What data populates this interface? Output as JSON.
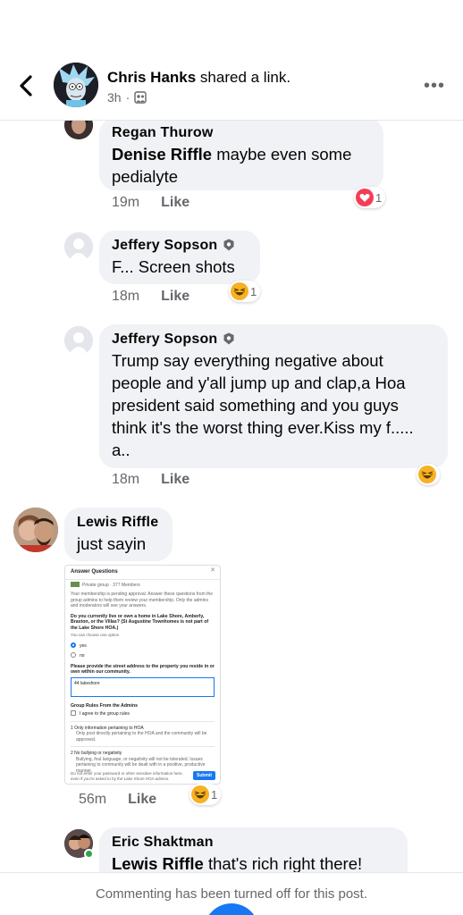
{
  "post_header": {
    "author": "Chris Hanks",
    "action": " shared a link.",
    "time": "3h",
    "separator": "·",
    "audience_icon": "group-icon",
    "more_icon": "more-horizontal-icon"
  },
  "comments": [
    {
      "author": "Regan Thurow",
      "tag": "Denise Riffle",
      "text": " maybe even some pedialyte",
      "time": "19m",
      "like_label": "Like",
      "reaction": {
        "type": "love",
        "count": "1"
      }
    },
    {
      "author": "Jeffery Sopson",
      "text": "F... Screen shots",
      "time": "18m",
      "like_label": "Like",
      "reaction": {
        "type": "haha",
        "count": "1"
      }
    },
    {
      "author": "Jeffery Sopson",
      "text": "Trump say everything negative about people and y'all jump up and clap,a Hoa president said something and you guys think it's the worst thing ever.Kiss my f..... a..",
      "time": "18m",
      "like_label": "Like",
      "reaction": {
        "type": "haha",
        "count": ""
      }
    },
    {
      "author": "Lewis Riffle",
      "text": "just sayin",
      "time": "56m",
      "like_label": "Like",
      "reaction": {
        "type": "haha",
        "count": "1"
      }
    },
    {
      "author": "Eric Shaktman",
      "tag": "Lewis Riffle",
      "text": "  that's rich right there!"
    }
  ],
  "screenshot": {
    "title": "Answer Questions",
    "group_line": "Private group · 377 Members",
    "intro": "Your membership is pending approval. Answer these questions from the group admins to help them review your membership. Only the admins and moderators will see your answers.",
    "q1": "Do you currently live or own a home in Lake Shore, Amberly, Braxton, or the Villas? (St Augustine Townhomes is not part of the Lake Shore HOA.)",
    "q1_hint": "You can choose one option",
    "opt_yes": "yes",
    "opt_no": "no",
    "q2": "Please provide the street address to the property you reside in or own within our community.",
    "q2_answer": "44 lakeshore",
    "rules_title": "Group Rules From the Admins",
    "agree": "I agree to the group rules",
    "rule1_title": "1  Only information pertaining to HOA",
    "rule1_text": "Only post directly pertaining to the HOA and the community will be approved.",
    "rule2_title": "2  No bullying or negativity",
    "rule2_text": "Bullying, foul language, or negativity will not be tolerated. Issues pertaining to community will be dealt with in a positive, productive manner.",
    "footer_note": "Do not enter your password or other sensitive information here, even if you're asked to by the Lake Shore HOA admins.",
    "submit": "Submit"
  },
  "footer": {
    "notice": "Commenting has been turned off for this post."
  },
  "colors": {
    "accent": "#1877f2",
    "bubble": "#f0f2f5",
    "muted": "#65676b",
    "love": "#f33e58",
    "haha": "#f7b125"
  }
}
